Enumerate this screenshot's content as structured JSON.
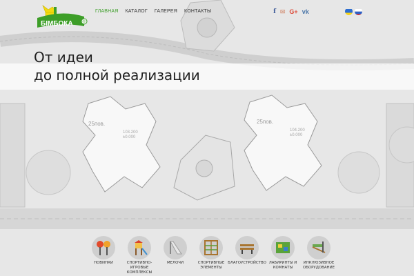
{
  "brand": {
    "name": "БІМБОКА",
    "reg": "®"
  },
  "nav": {
    "items": [
      {
        "label": "ГЛАВНАЯ",
        "active": true
      },
      {
        "label": "КАТАЛОГ",
        "active": false
      },
      {
        "label": "ГАЛЕРЕЯ",
        "active": false
      },
      {
        "label": "КОНТАКТЫ",
        "active": false
      }
    ]
  },
  "social": {
    "facebook": "f",
    "email": "✉",
    "google": "G+",
    "vk": "vk"
  },
  "hero": {
    "line1": "От идеи",
    "line2": "до полной реализации"
  },
  "plan_labels": {
    "left_floors": "25пов.",
    "left_elev_top": "103.200",
    "left_elev_bottom": "±0.000",
    "right_floors": "25пов.",
    "right_elev_top": "104.200",
    "right_elev_bottom": "±0.000"
  },
  "categories": [
    {
      "label": "НОВИНКИ",
      "icon": "new-items-icon"
    },
    {
      "label": "СПОРТИВНО-ИГРОВЫЕ КОМПЛЕКСЫ",
      "icon": "play-complex-icon"
    },
    {
      "label": "МЕЛОЧИ",
      "icon": "slide-icon"
    },
    {
      "label": "СПОРТИВНЫЕ ЭЛЕМЕНТЫ",
      "icon": "sport-frame-icon"
    },
    {
      "label": "БЛАГОУСТРОЙСТВО",
      "icon": "bench-icon"
    },
    {
      "label": "ЛАБИРИНТЫ И КОМНАТЫ",
      "icon": "labyrinth-icon"
    },
    {
      "label": "ИНКЛЮЗИВНОЕ ОБОРУДОВАНИЕ",
      "icon": "inclusive-equipment-icon"
    }
  ],
  "colors": {
    "accent_green": "#3d9e28",
    "logo_yellow": "#f2d90f",
    "facebook": "#3b5998",
    "email": "#d8a48f",
    "google": "#dd4b39",
    "vk": "#4a76a8"
  }
}
